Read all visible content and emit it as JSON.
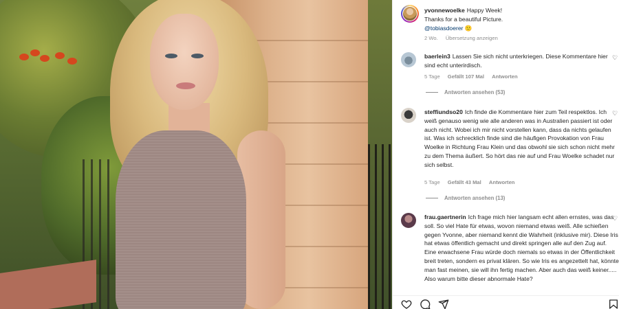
{
  "post": {
    "username": "yvonnewoelke",
    "caption_line1": "Happy Week!",
    "caption_line2": "Thanks for a beautiful Picture.",
    "mention": "@tobiasdoerer",
    "emoji": "🙂",
    "age": "2 Wo.",
    "translate": "Übersetzung anzeigen"
  },
  "comments": [
    {
      "username": "baerlein3",
      "text": "Lassen Sie sich nicht unterkriegen. Diese Kommentare hier sind echt unterirdisch.",
      "age": "5 Tage",
      "likes": "Gefällt 107 Mal",
      "reply": "Antworten",
      "view_replies": "Antworten ansehen (53)"
    },
    {
      "username": "steffiundso20",
      "text": "Ich finde die Kommentare hier zum Teil respektlos. Ich weiß genauso wenig wie alle anderen was in Australien passiert ist oder auch nicht. Wobei ich mir nicht vorstellen kann, dass da nichts gelaufen ist. Was ich schrecklich finde sind die häufigen Provokation von Frau Woelke in Richtung Frau Klein und das obwohl sie sich schon nicht mehr zu dem Thema äußert. So hört das nie auf und Frau Woelke schadet nur sich selbst.",
      "age": "5 Tage",
      "likes": "Gefällt 43 Mal",
      "reply": "Antworten",
      "view_replies": "Antworten ansehen (13)"
    },
    {
      "username": "frau.gaertnerin",
      "text": "Ich frage mich hier langsam echt allen ernstes, was das soll. So viel Hate für etwas, wovon niemand etwas weiß. Alle schießen gegen Yvonne, aber niemand kennt die Wahrheit (inklusive mir). Diese Iris hat etwas öffentlich gemacht und direkt springen alle auf den Zug auf. Eine erwachsene Frau würde doch niemals so etwas in der Öffentlichkeit breit treten, sondern es privat klären. So wie Iris es angezettelt hat, könnte man fast meinen, sie will ihn fertig machen. Aber auch das weiß keiner..... Also warum bitte dieser abnormale Hate?"
    }
  ],
  "icons": {
    "like": "heart-icon",
    "comment": "comment-icon",
    "share": "paper-plane-icon",
    "save": "bookmark-icon"
  }
}
